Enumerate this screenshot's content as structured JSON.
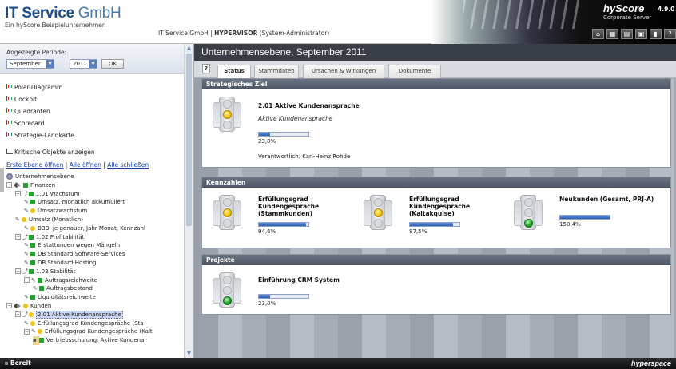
{
  "header": {
    "brand_title": "IT Service",
    "brand_title_suffix": "GmbH",
    "brand_subtitle": "Ein hyScore Beispielunternehmen",
    "context_prefix": "IT Service GmbH | ",
    "context_user": "HYPERVISOR",
    "context_role": " (System-Administrator)",
    "product_name": "hyScore",
    "product_edition": "Corporate Server",
    "product_version": "4.9.0",
    "toolbar": [
      "home-icon",
      "grid-icon",
      "print-icon",
      "window-icon",
      "book-icon",
      "help-icon"
    ],
    "toolbar_glyphs": [
      "⌂",
      "▦",
      "▤",
      "▣",
      "▮",
      "?"
    ]
  },
  "left": {
    "period_label": "Angezeigte Periode:",
    "month": "September",
    "year": "2011",
    "ok_label": "OK",
    "nav_links": [
      "Polar-Diagramm",
      "Cockpit",
      "Quadranten",
      "Scorecard",
      "Strategie-Landkarte"
    ],
    "crit_label": "Kritische Objekte anzeigen",
    "link_first": "Erste Ebene öffnen",
    "link_all_open": "Alle öffnen",
    "link_all_close": "Alle schließen",
    "sep": " | ",
    "tree": [
      {
        "indent": 0,
        "label": "Unternehmensebene",
        "icon": "root"
      },
      {
        "indent": 0,
        "label": "Finanzen",
        "icon": "diamond",
        "color": "g",
        "exp": "−"
      },
      {
        "indent": 1,
        "label": "1.01 Wachstum",
        "icon": "branch",
        "color": "g",
        "exp": "−",
        "shape": "sq"
      },
      {
        "indent": 2,
        "label": "Umsatz, monatlich akkumuliert",
        "icon": "pen",
        "color": "g",
        "shape": "sq"
      },
      {
        "indent": 2,
        "label": "Umsatzwachstum",
        "icon": "pen",
        "color": "y",
        "shape": "dot"
      },
      {
        "indent": 1,
        "label": "Umsatz (Monatlich)",
        "icon": "pen",
        "color": "y",
        "shape": "dot"
      },
      {
        "indent": 2,
        "label": "BBB: je genauer, Jahr Monat, Kennzahl",
        "icon": "pen",
        "color": "y",
        "shape": "dot"
      },
      {
        "indent": 1,
        "label": "1.02 Profitabilität",
        "icon": "branch",
        "color": "g",
        "exp": "−",
        "shape": "sq"
      },
      {
        "indent": 2,
        "label": "Erstattungen wegen Mängeln",
        "icon": "pen",
        "color": "g",
        "shape": "sq"
      },
      {
        "indent": 2,
        "label": "DB Standard Software-Services",
        "icon": "pen",
        "color": "g",
        "shape": "sq"
      },
      {
        "indent": 2,
        "label": "DB Standard-Hosting",
        "icon": "pen",
        "color": "g",
        "shape": "sq"
      },
      {
        "indent": 1,
        "label": "1.03 Stabilität",
        "icon": "branch",
        "color": "g",
        "exp": "−",
        "shape": "sq"
      },
      {
        "indent": 2,
        "label": "Auftragsreichweite",
        "icon": "pen",
        "color": "g",
        "shape": "sq",
        "exp": "−"
      },
      {
        "indent": 3,
        "label": "Auftragsbestand",
        "icon": "pen",
        "color": "g",
        "shape": "sq"
      },
      {
        "indent": 2,
        "label": "Liquiditätsreichweite",
        "icon": "pen",
        "color": "g",
        "shape": "sq"
      },
      {
        "indent": 0,
        "label": "Kunden",
        "icon": "diamond",
        "color": "y",
        "exp": "−",
        "shape": "dot"
      },
      {
        "indent": 1,
        "label": "2.01 Aktive Kundenansprache",
        "icon": "branch",
        "color": "y",
        "exp": "−",
        "shape": "dot",
        "selected": true
      },
      {
        "indent": 2,
        "label": "Erfüllungsgrad Kundengespräche (Sta",
        "icon": "pen",
        "color": "y",
        "shape": "dot"
      },
      {
        "indent": 2,
        "label": "Erfüllungsgrad Kundengespräche (Kalt",
        "icon": "pen",
        "color": "y",
        "shape": "dot",
        "exp": "−"
      },
      {
        "indent": 3,
        "label": "Vertriebsschulung: Aktive Kundena",
        "icon": "proj",
        "color": "g",
        "shape": "sq"
      }
    ]
  },
  "main": {
    "title": "Unternehmensebene, September 2011",
    "help": "?",
    "tabs": [
      "Status",
      "Stammdaten",
      "Ursachen & Wirkungen",
      "Dokumente"
    ],
    "strategic": {
      "header": "Strategisches Ziel",
      "title": "2.01 Aktive Kundenansprache",
      "subtitle": "Aktive Kundenansprache",
      "progress": 0.23,
      "pct": "23,0%",
      "owner_label": "Verantwortlich: Karl-Heinz Rohde"
    },
    "kpis": {
      "header": "Kennzahlen",
      "items": [
        {
          "title": "Erfüllungsgrad Kundengespräche (Stammkunden)",
          "pct": "94,6%",
          "progress": 0.946,
          "light": "yellow"
        },
        {
          "title": "Erfüllungsgrad Kundengespräche (Kaltakquise)",
          "pct": "87,5%",
          "progress": 0.875,
          "light": "yellow"
        },
        {
          "title": "Neukunden (Gesamt, PRJ-A)",
          "pct": "158,4%",
          "progress": 1.0,
          "light": "green"
        }
      ]
    },
    "projects": {
      "header": "Projekte",
      "title": "Einführung CRM System",
      "progress": 0.23,
      "pct": "23,0%",
      "light": "green"
    }
  },
  "statusbar": {
    "status": "Bereit",
    "brand": "hyperspace"
  }
}
